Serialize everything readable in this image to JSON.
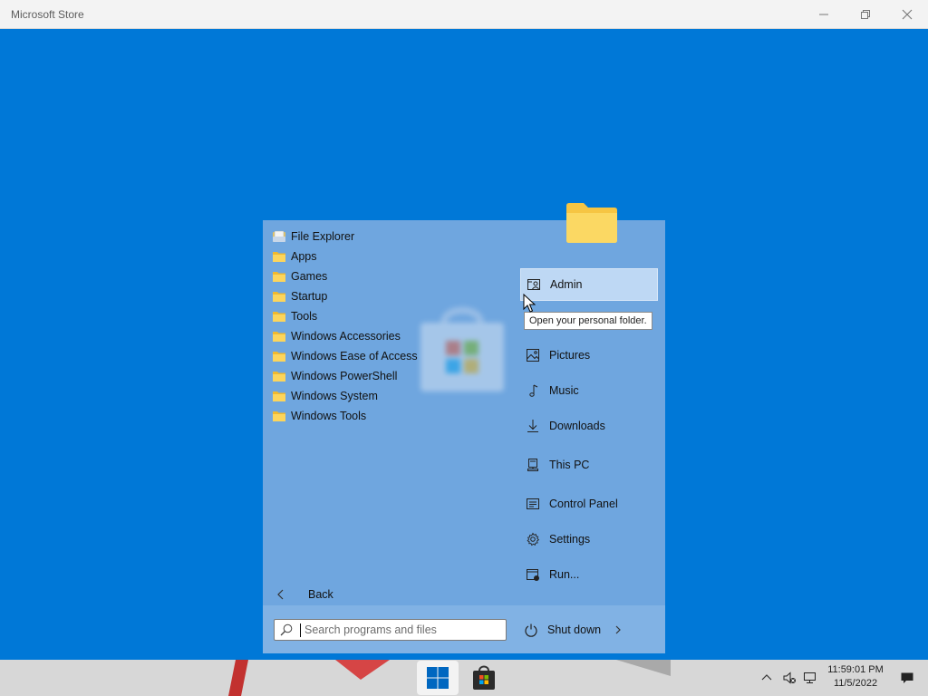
{
  "window": {
    "title": "Microsoft Store",
    "minimize_icon": "minimize-icon",
    "restore_icon": "restore-icon",
    "close_icon": "close-icon"
  },
  "start_menu": {
    "left_items": [
      {
        "label": "File Explorer",
        "icon": "file-explorer-icon"
      },
      {
        "label": "Apps",
        "icon": "folder-icon"
      },
      {
        "label": "Games",
        "icon": "folder-icon"
      },
      {
        "label": "Startup",
        "icon": "folder-icon"
      },
      {
        "label": "Tools",
        "icon": "folder-icon"
      },
      {
        "label": "Windows Accessories",
        "icon": "folder-icon"
      },
      {
        "label": "Windows Ease of Access",
        "icon": "folder-icon"
      },
      {
        "label": "Windows PowerShell",
        "icon": "folder-icon"
      },
      {
        "label": "Windows System",
        "icon": "folder-icon"
      },
      {
        "label": "Windows Tools",
        "icon": "folder-icon"
      }
    ],
    "right_items": {
      "admin": "Admin",
      "pictures": "Pictures",
      "music": "Music",
      "downloads": "Downloads",
      "this_pc": "This PC",
      "control_panel": "Control Panel",
      "settings": "Settings",
      "run": "Run..."
    },
    "tooltip": "Open your personal folder.",
    "back_label": "Back",
    "search_placeholder": "Search programs and files",
    "shutdown_label": "Shut down"
  },
  "taskbar": {
    "time": "11:59:01 PM",
    "date": "11/5/2022",
    "apps": [
      "start-button",
      "microsoft-store"
    ]
  },
  "colors": {
    "desktop": "#0078d7",
    "accent": "#0067c0"
  }
}
